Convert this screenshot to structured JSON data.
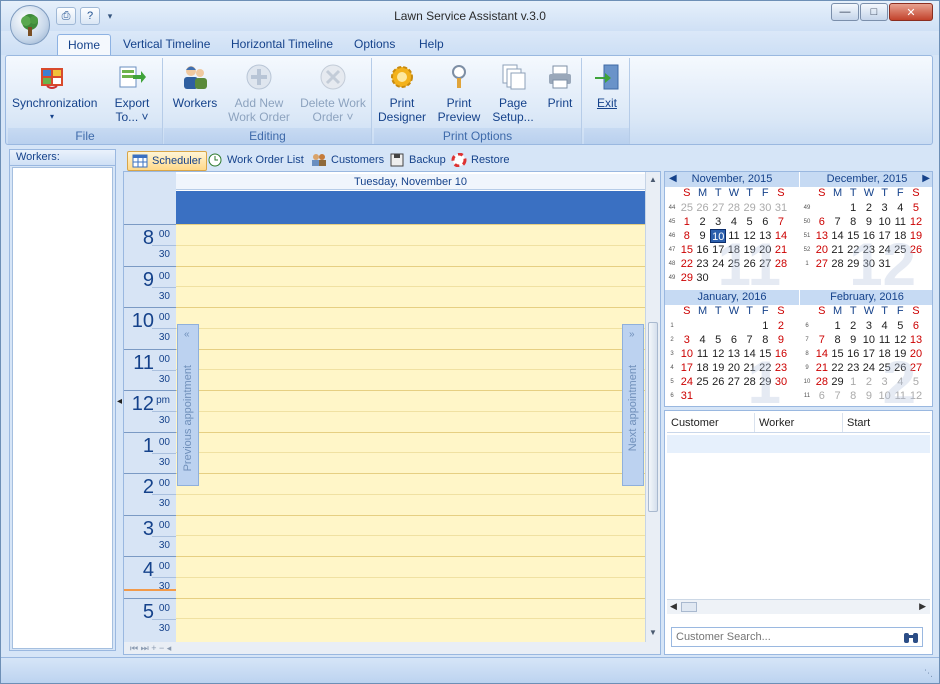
{
  "window": {
    "title": "Lawn Service Assistant v.3.0"
  },
  "ribbon_tabs": [
    {
      "label": "Home",
      "active": true
    },
    {
      "label": "Vertical Timeline"
    },
    {
      "label": "Horizontal Timeline"
    },
    {
      "label": "Options"
    },
    {
      "label": "Help"
    }
  ],
  "ribbon": {
    "file": {
      "label": "File",
      "sync": "Synchronization",
      "export_l1": "Export",
      "export_l2": "To... ˅"
    },
    "editing": {
      "label": "Editing",
      "workers": "Workers",
      "add_l1": "Add New",
      "add_l2": "Work Order",
      "del_l1": "Delete Work",
      "del_l2": "Order ˅"
    },
    "print": {
      "label": "Print Options",
      "designer_l1": "Print",
      "designer_l2": "Designer",
      "preview_l1": "Print",
      "preview_l2": "Preview",
      "setup_l1": "Page",
      "setup_l2": "Setup...",
      "print": "Print"
    },
    "exit": {
      "label": "Exit"
    }
  },
  "workers_panel": {
    "title": "Workers:"
  },
  "subtabs": [
    {
      "label": "Scheduler",
      "active": true
    },
    {
      "label": "Work Order List"
    },
    {
      "label": "Customers"
    },
    {
      "label": "Backup"
    },
    {
      "label": "Restore"
    }
  ],
  "scheduler": {
    "date_header": "Tuesday, November 10",
    "prev_appointment": "Previous appointment",
    "next_appointment": "Next appointment",
    "hours": [
      {
        "h": "8",
        "s": "00",
        "half": "30"
      },
      {
        "h": "9",
        "s": "00",
        "half": "30"
      },
      {
        "h": "10",
        "s": "00",
        "half": "30"
      },
      {
        "h": "11",
        "s": "00",
        "half": "30"
      },
      {
        "h": "12",
        "s": "pm",
        "half": "30"
      },
      {
        "h": "1",
        "s": "00",
        "half": "30"
      },
      {
        "h": "2",
        "s": "00",
        "half": "30"
      },
      {
        "h": "3",
        "s": "00",
        "half": "30"
      },
      {
        "h": "4",
        "s": "00",
        "half": "30"
      },
      {
        "h": "5",
        "s": "00",
        "half": "30"
      }
    ]
  },
  "calendar": {
    "weekdays": [
      "S",
      "M",
      "T",
      "W",
      "T",
      "F",
      "S"
    ],
    "months": [
      {
        "title": "November, 2015",
        "big": "11",
        "weeks": [
          {
            "wn": "44",
            "days": [
              "25",
              "26",
              "27",
              "28",
              "29",
              "30",
              "31"
            ],
            "other": [
              0,
              1,
              2,
              3,
              4,
              5,
              6
            ]
          },
          {
            "wn": "45",
            "days": [
              "1",
              "2",
              "3",
              "4",
              "5",
              "6",
              "7"
            ]
          },
          {
            "wn": "46",
            "days": [
              "8",
              "9",
              "10",
              "11",
              "12",
              "13",
              "14"
            ],
            "today": 2
          },
          {
            "wn": "47",
            "days": [
              "15",
              "16",
              "17",
              "18",
              "19",
              "20",
              "21"
            ]
          },
          {
            "wn": "48",
            "days": [
              "22",
              "23",
              "24",
              "25",
              "26",
              "27",
              "28"
            ]
          },
          {
            "wn": "49",
            "days": [
              "29",
              "30",
              "",
              "",
              "",
              "",
              ""
            ]
          }
        ]
      },
      {
        "title": "December, 2015",
        "big": "12",
        "weeks": [
          {
            "wn": "49",
            "days": [
              "",
              "",
              "1",
              "2",
              "3",
              "4",
              "5"
            ]
          },
          {
            "wn": "50",
            "days": [
              "6",
              "7",
              "8",
              "9",
              "10",
              "11",
              "12"
            ]
          },
          {
            "wn": "51",
            "days": [
              "13",
              "14",
              "15",
              "16",
              "17",
              "18",
              "19"
            ]
          },
          {
            "wn": "52",
            "days": [
              "20",
              "21",
              "22",
              "23",
              "24",
              "25",
              "26"
            ]
          },
          {
            "wn": "1",
            "days": [
              "27",
              "28",
              "29",
              "30",
              "31",
              "",
              ""
            ]
          }
        ]
      },
      {
        "title": "January, 2016",
        "big": "1",
        "weeks": [
          {
            "wn": "1",
            "days": [
              "",
              "",
              "",
              "",
              "",
              "1",
              "2"
            ]
          },
          {
            "wn": "2",
            "days": [
              "3",
              "4",
              "5",
              "6",
              "7",
              "8",
              "9"
            ]
          },
          {
            "wn": "3",
            "days": [
              "10",
              "11",
              "12",
              "13",
              "14",
              "15",
              "16"
            ]
          },
          {
            "wn": "4",
            "days": [
              "17",
              "18",
              "19",
              "20",
              "21",
              "22",
              "23"
            ]
          },
          {
            "wn": "5",
            "days": [
              "24",
              "25",
              "26",
              "27",
              "28",
              "29",
              "30"
            ]
          },
          {
            "wn": "6",
            "days": [
              "31",
              "",
              "",
              "",
              "",
              "",
              ""
            ]
          }
        ]
      },
      {
        "title": "February, 2016",
        "big": "2",
        "weeks": [
          {
            "wn": "6",
            "days": [
              "",
              "1",
              "2",
              "3",
              "4",
              "5",
              "6"
            ]
          },
          {
            "wn": "7",
            "days": [
              "7",
              "8",
              "9",
              "10",
              "11",
              "12",
              "13"
            ]
          },
          {
            "wn": "8",
            "days": [
              "14",
              "15",
              "16",
              "17",
              "18",
              "19",
              "20"
            ]
          },
          {
            "wn": "9",
            "days": [
              "21",
              "22",
              "23",
              "24",
              "25",
              "26",
              "27"
            ]
          },
          {
            "wn": "10",
            "days": [
              "28",
              "29",
              "1",
              "2",
              "3",
              "4",
              "5"
            ],
            "other": [
              2,
              3,
              4,
              5,
              6
            ]
          },
          {
            "wn": "11",
            "days": [
              "6",
              "7",
              "8",
              "9",
              "10",
              "11",
              "12"
            ],
            "other": [
              0,
              1,
              2,
              3,
              4,
              5,
              6
            ]
          }
        ]
      }
    ]
  },
  "customers_grid": {
    "columns": [
      "Customer",
      "Worker",
      "Start"
    ],
    "search_placeholder": "Customer Search..."
  },
  "colors": {
    "accent": "#3a70c2",
    "today": "#2b5fad",
    "slot": "#fff6c8"
  }
}
